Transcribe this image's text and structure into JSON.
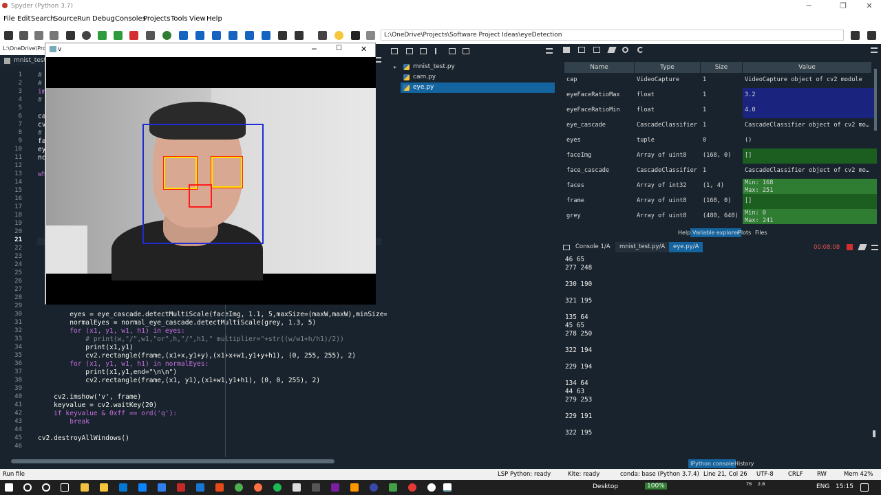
{
  "window": {
    "title": "Spyder (Python 3.7)"
  },
  "menu": [
    "File",
    "Edit",
    "Search",
    "Source",
    "Run",
    "Debug",
    "Consoles",
    "Projects",
    "Tools",
    "View",
    "Help"
  ],
  "toolbar": {
    "path": "L:\\OneDrive\\Projects\\Software Project Ideas\\eyeDetection"
  },
  "editor": {
    "path_short": "L:\\OneDrive\\Proj",
    "tab": "mnist_test.py",
    "line_numbers": [
      "1",
      "2",
      "3",
      "4",
      "5",
      "6",
      "7",
      "8",
      "9",
      "10",
      "11",
      "12",
      "13",
      "14",
      "15",
      "16",
      "17",
      "18",
      "19",
      "20",
      "21",
      "22",
      "23",
      "24",
      "25",
      "26",
      "27",
      "28",
      "29",
      "30",
      "31",
      "32",
      "33",
      "34",
      "35",
      "36",
      "37",
      "38",
      "39",
      "40",
      "41",
      "42",
      "43",
      "44",
      "45",
      "46"
    ],
    "left_chars": [
      "#",
      "#",
      "im",
      "#",
      "",
      "ca",
      "cv",
      "#",
      "fa",
      "ey",
      "nc",
      "",
      "wh"
    ],
    "code_lines": [
      "        eyes = eye_cascade.detectMultiScale(faceImg, 1.1, 5,maxSize=(maxW,maxW),minSize=(m",
      "        normalEyes = normal_eye_cascade.detectMultiScale(grey, 1.3, 5)",
      "        for (x1, y1, w1, h1) in eyes:",
      "            # print(w,\"/\",w1,\"or\",h,\"/\",h1,\" multiplier=\"+str((w/w1+h/h1)/2))",
      "            print(x1,y1)",
      "            cv2.rectangle(frame,(x1+x,y1+y),(x1+x+w1,y1+y+h1), (0, 255, 255), 2)",
      "        for (x1, y1, w1, h1) in normalEyes:",
      "            print(x1,y1,end=\"\\n\\n\")",
      "            cv2.rectangle(frame,(x1, y1),(x1+w1,y1+h1), (0, 0, 255), 2)",
      "",
      "    cv2.imshow('v', frame)",
      "    keyvalue = cv2.waitKey(20)",
      "    if keyvalue & 0xff == ord('q'):",
      "        break",
      "",
      "cv2.destroyAllWindows()"
    ]
  },
  "popup": {
    "title": "v"
  },
  "files": [
    "mnist_test.py",
    "cam.py",
    "eye.py"
  ],
  "varexp": {
    "headers": [
      "Name",
      "Type",
      "Size",
      "Value"
    ],
    "rows": [
      {
        "name": "cap",
        "type": "VideoCapture",
        "size": "1",
        "value": "VideoCapture object of cv2 module",
        "color": "#19232d"
      },
      {
        "name": "eyeFaceRatioMax",
        "type": "float",
        "size": "1",
        "value": "3.2",
        "color": "#1a237e"
      },
      {
        "name": "eyeFaceRatioMin",
        "type": "float",
        "size": "1",
        "value": "4.0",
        "color": "#1a237e"
      },
      {
        "name": "eye_cascade",
        "type": "CascadeClassifier",
        "size": "1",
        "value": "CascadeClassifier object of cv2 mo…",
        "color": "#19232d"
      },
      {
        "name": "eyes",
        "type": "tuple",
        "size": "0",
        "value": "()",
        "color": "#19232d"
      },
      {
        "name": "faceImg",
        "type": "Array of uint8",
        "size": "(168, 0)",
        "value": "[]",
        "color": "#1b5e20"
      },
      {
        "name": "face_cascade",
        "type": "CascadeClassifier",
        "size": "1",
        "value": "CascadeClassifier object of cv2 mo…",
        "color": "#19232d"
      },
      {
        "name": "faces",
        "type": "Array of int32",
        "size": "(1, 4)",
        "value": "Min: 168\nMax: 251",
        "color": "#2e7d32"
      },
      {
        "name": "frame",
        "type": "Array of uint8",
        "size": "(168, 0)",
        "value": "[]",
        "color": "#1b5e20"
      },
      {
        "name": "grey",
        "type": "Array of uint8",
        "size": "(480, 640)",
        "value": "Min: 0\nMax: 241",
        "color": "#2e7d32"
      }
    ],
    "bottom_tabs": [
      "Help",
      "Variable explorer",
      "Plots",
      "Files"
    ]
  },
  "console": {
    "tabs": [
      "Console 1/A",
      "mnist_test.py/A",
      "eye.py/A"
    ],
    "timer": "00:08:08",
    "lines": [
      "46 65",
      "277 248",
      "",
      "230 190",
      "",
      "321 195",
      "",
      "135 64",
      "45 65",
      "278 250",
      "",
      "322 194",
      "",
      "229 194",
      "",
      "134 64",
      "44 63",
      "279 253",
      "",
      "229 191",
      "",
      "322 195"
    ],
    "bottom_tabs": [
      "IPython console",
      "History"
    ]
  },
  "status": {
    "left": "Run file",
    "lsp": "LSP Python: ready",
    "kite": "Kite: ready",
    "conda": "conda: base (Python 3.7.4)",
    "pos": "Line 21, Col 26",
    "enc": "UTF-8",
    "eol": "CRLF",
    "rw": "RW",
    "mem": "Mem 42%"
  },
  "taskbar": {
    "desktop": "Desktop",
    "battery": "100%",
    "lang": "ENG",
    "time": "15:15",
    "net": "76",
    "net2": "2.8"
  }
}
